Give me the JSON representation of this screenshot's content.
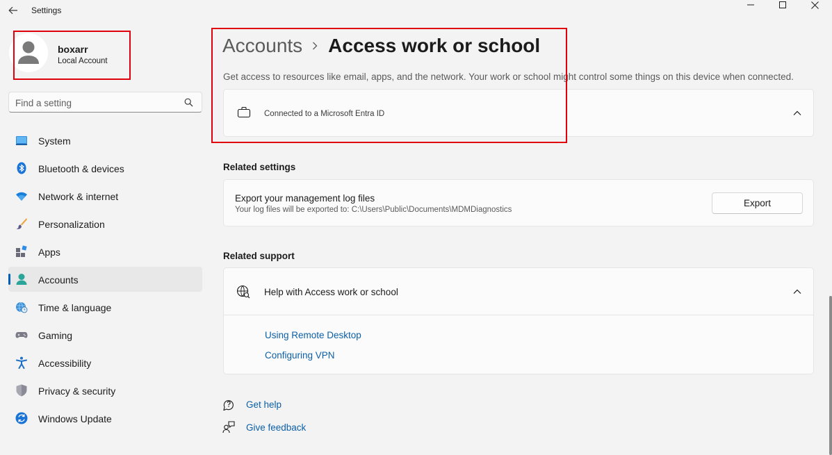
{
  "window": {
    "title": "Settings"
  },
  "profile": {
    "name": "boxarr",
    "account_type": "Local Account"
  },
  "search": {
    "placeholder": "Find a setting"
  },
  "sidebar": {
    "selected": "Accounts",
    "items": [
      {
        "label": "System",
        "icon": "system-icon"
      },
      {
        "label": "Bluetooth & devices",
        "icon": "bluetooth-icon"
      },
      {
        "label": "Network & internet",
        "icon": "wifi-icon"
      },
      {
        "label": "Personalization",
        "icon": "paintbrush-icon"
      },
      {
        "label": "Apps",
        "icon": "apps-icon"
      },
      {
        "label": "Accounts",
        "icon": "accounts-icon"
      },
      {
        "label": "Time & language",
        "icon": "globe-clock-icon"
      },
      {
        "label": "Gaming",
        "icon": "gamepad-icon"
      },
      {
        "label": "Accessibility",
        "icon": "accessibility-icon"
      },
      {
        "label": "Privacy & security",
        "icon": "shield-icon"
      },
      {
        "label": "Windows Update",
        "icon": "update-icon"
      }
    ]
  },
  "breadcrumb": {
    "parent": "Accounts",
    "current": "Access work or school"
  },
  "description": "Get access to resources like email, apps, and the network. Your work or school might control some things on this device when connected.",
  "connection": {
    "label": "Connected to a Microsoft Entra ID",
    "icon": "briefcase-icon",
    "expanded": true
  },
  "related_settings": {
    "heading": "Related settings",
    "export": {
      "title": "Export your management log files",
      "subtitle": "Your log files will be exported to: C:\\Users\\Public\\Documents\\MDMDiagnostics",
      "button_label": "Export"
    }
  },
  "related_support": {
    "heading": "Related support",
    "title": "Help with Access work or school",
    "expanded": true,
    "links": [
      "Using Remote Desktop",
      "Configuring VPN"
    ]
  },
  "footer": {
    "get_help": "Get help",
    "give_feedback": "Give feedback"
  },
  "colors": {
    "accent": "#005fb8",
    "link": "#0c5fa8",
    "highlight_box": "#e0000b",
    "background": "#f3f3f3"
  }
}
